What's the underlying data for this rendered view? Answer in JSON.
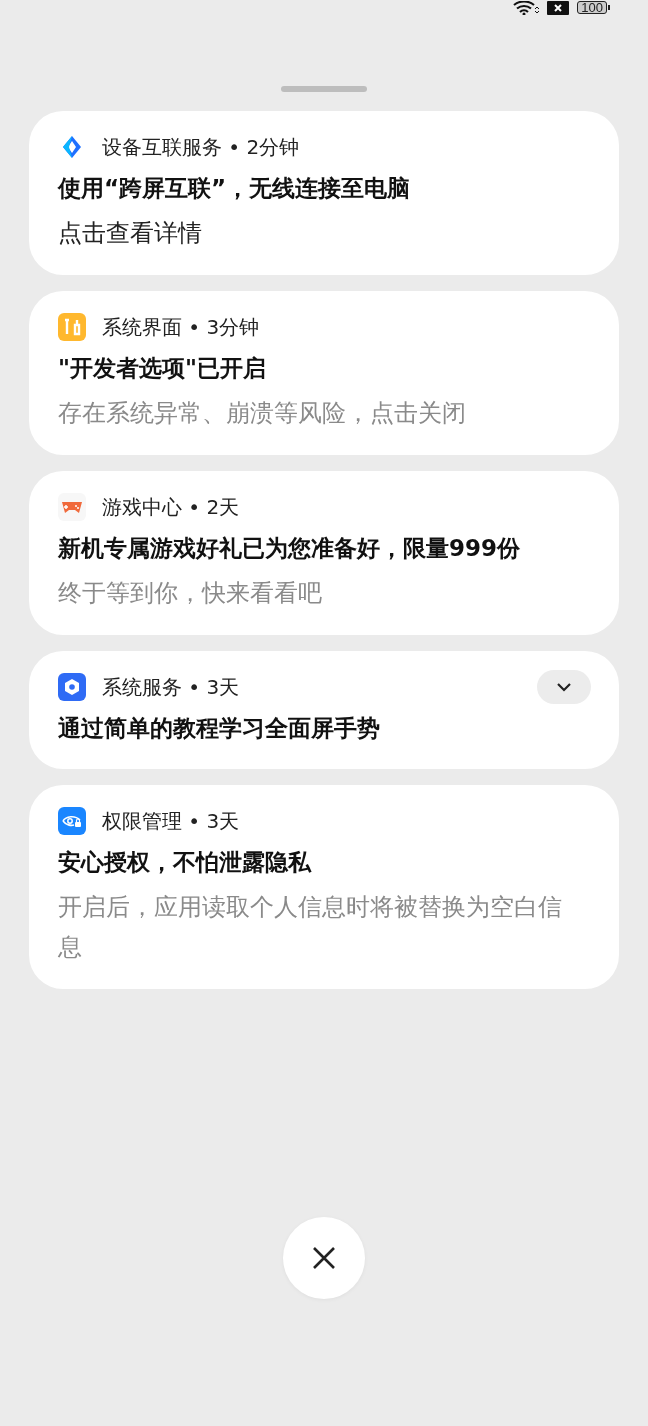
{
  "status_bar": {
    "battery": "100"
  },
  "notifications": [
    {
      "kind": "interconnect",
      "app": "设备互联服务",
      "separator": "•",
      "time": "2分钟",
      "title": "使用“跨屏互联”，无线连接至电脑",
      "body": "点击查看详情",
      "body_dimmed": false
    },
    {
      "kind": "system-ui",
      "app": "系统界面",
      "separator": "•",
      "time": "3分钟",
      "title": "\"开发者选项\"已开启",
      "body": "存在系统异常、崩溃等风险，点击关闭",
      "body_dimmed": true
    },
    {
      "kind": "game",
      "app": "游戏中心",
      "separator": "•",
      "time": "2天",
      "title": "新机专属游戏好礼已为您准备好，限量999份",
      "body": "终于等到你，快来看看吧",
      "body_dimmed": true
    },
    {
      "kind": "service",
      "app": "系统服务",
      "separator": "•",
      "time": "3天",
      "title": "通过简单的教程学习全面屏手势",
      "expanded": false
    },
    {
      "kind": "permission",
      "app": "权限管理",
      "separator": "•",
      "time": "3天",
      "title": "安心授权，不怕泄露隐私",
      "body": "开启后，应用读取个人信息时将被替换为空白信息",
      "body_dimmed": true
    }
  ]
}
